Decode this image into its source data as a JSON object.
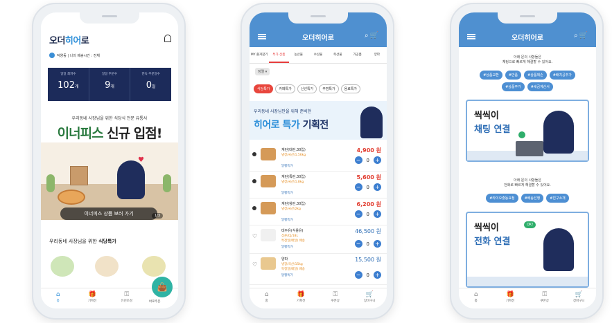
{
  "phone1": {
    "logo_prefix": "오더",
    "logo_hl": "히어",
    "logo_suffix": "로",
    "address": "작양동 | 나의 배송시간 : 전체",
    "stats": [
      {
        "label": "일일 최저수",
        "value": "102",
        "unit": "개"
      },
      {
        "label": "일일 주문수",
        "value": "9",
        "unit": "개"
      },
      {
        "label": "연속 주문일수",
        "value": "0",
        "unit": "일"
      }
    ],
    "promo_sub": "우리동네 사장님을 위한 식당식 전문 유통사",
    "promo_title_a": "이너피스",
    "promo_title_b": " 신규 입점!",
    "banner_button": "이너피스 상품 보러 가기",
    "banner_pager": "1/3",
    "section_prefix": "우리동네 사장님을 위한 ",
    "section_bold": "식당특가",
    "tabs": [
      {
        "icon": "⌂",
        "label": "홈"
      },
      {
        "icon": "🎁",
        "label": "기획전"
      },
      {
        "icon": "⚿",
        "label": "유진조성"
      }
    ],
    "fab_icon": "👜",
    "fab_label": "바로주문"
  },
  "phone2": {
    "title": "오더히어로",
    "header_icons": "⌕🛒",
    "cat_tabs": [
      "MY 즐겨찾기",
      "특가 상품",
      "농산물",
      "수산물",
      "축산물",
      "가공품",
      "양파"
    ],
    "sort_label": "정렬 ▾",
    "chips": [
      "식당특가",
      "카페특가",
      "신선특가",
      "주점특가",
      "음료특가"
    ],
    "banner_line1": "우리동네 사장님만을 위해 준비한",
    "banner_bold_a": "히어로 특가",
    "banner_bold_b": " 기획전",
    "products": [
      {
        "name": "계란(대란,30입)",
        "meta": "냉장/국산/1.56kg",
        "meta2": "",
        "tag": "달팽특가",
        "price": "4,900 원",
        "qty": "0",
        "blue": false
      },
      {
        "name": "계란(특란,30입)",
        "meta": "냉장/국산/1.8kg",
        "meta2": "",
        "tag": "달팽특가",
        "price": "5,600 원",
        "qty": "0",
        "blue": false
      },
      {
        "name": "계란(왕란,30입)",
        "meta": "냉장/국산/2kg",
        "meta2": "",
        "tag": "달팽특가",
        "price": "6,200 원",
        "qty": "0",
        "blue": false
      },
      {
        "name": "대두유(식용유)",
        "meta": "상온/CJ/18L",
        "meta2": "특정일(배달) 배송",
        "tag": "달팽특가",
        "price": "46,500 원",
        "qty": "0",
        "blue": true
      },
      {
        "name": "양파",
        "meta": "냉장/국산/15kg",
        "meta2": "특정일(배달) 배송",
        "tag": "달팽특가",
        "price": "15,500 원",
        "qty": "0",
        "blue": true
      }
    ],
    "tabs": [
      {
        "icon": "⌂",
        "label": "홈"
      },
      {
        "icon": "🎁",
        "label": "기획전"
      },
      {
        "icon": "⚿",
        "label": "쿠폰상"
      },
      {
        "icon": "🛒",
        "label": "장바구니"
      }
    ]
  },
  "phone3": {
    "title": "오더히어로",
    "header_icons": "⌕🛒",
    "help1_l1": "아래 문의 사항들은",
    "help1_l2": "채팅으로 빠르게 해결할 수 있어요.",
    "chips1": [
      "#상품교환",
      "#반품",
      "#상품제손",
      "#배치공추가",
      "#상품주가",
      "#세금계산서"
    ],
    "card1_t1": "씩씩이",
    "card1_t2": "채팅 연결",
    "help2_l1": "아래 문의 사항들은",
    "help2_l2": "전화로 빠르게 해결할 수 있어요.",
    "chips2": [
      "#라이오출동요청",
      "#배송선행",
      "#친구소개"
    ],
    "card2_t1": "씩씩이",
    "card2_t2": "전화 연결",
    "card2_bubble": "OK!",
    "tabs": [
      {
        "icon": "⌂",
        "label": "홈"
      },
      {
        "icon": "🎁",
        "label": "기획전"
      },
      {
        "icon": "⚿",
        "label": "쿠폰상"
      },
      {
        "icon": "🛒",
        "label": "장바구니"
      }
    ]
  }
}
